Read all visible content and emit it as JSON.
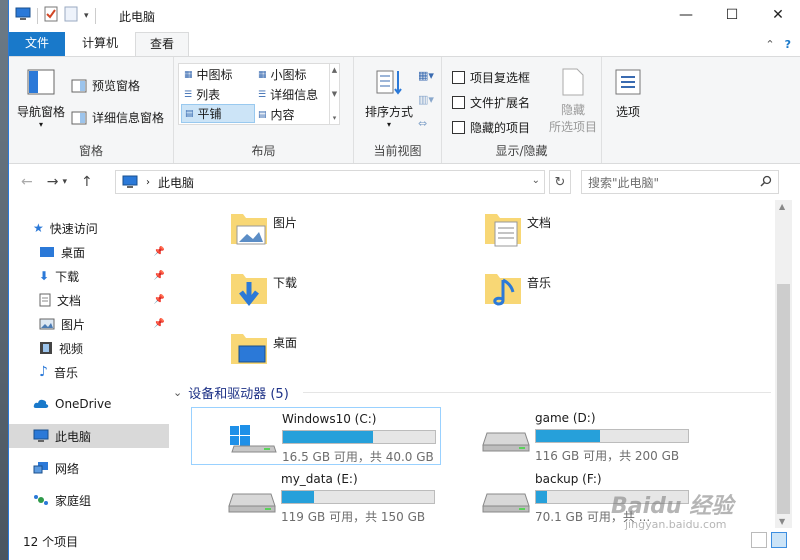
{
  "window": {
    "title": "此电脑"
  },
  "tabs": {
    "file": "文件",
    "computer": "计算机",
    "view": "查看"
  },
  "ribbon": {
    "pane": {
      "nav_pane": "导航窗格",
      "preview_pane": "预览窗格",
      "details_pane": "详细信息窗格",
      "label": "窗格"
    },
    "layout": {
      "items": [
        "中图标",
        "小图标",
        "列表",
        "详细信息",
        "平铺",
        "内容"
      ],
      "selected": "平铺",
      "label": "布局"
    },
    "current_view": {
      "sort": "排序方式",
      "label": "当前视图"
    },
    "show_hide": {
      "item_checkbox": "项目复选框",
      "file_ext": "文件扩展名",
      "hidden_items": "隐藏的项目",
      "hide": "隐藏",
      "selected_items": "所选项目",
      "label": "显示/隐藏"
    },
    "options": {
      "label": "选项"
    }
  },
  "address": {
    "path": "此电脑",
    "search_placeholder": "搜索\"此电脑\""
  },
  "sidebar": {
    "quick_access": "快速访问",
    "items": [
      "桌面",
      "下载",
      "文档",
      "图片",
      "视频",
      "音乐"
    ],
    "onedrive": "OneDrive",
    "this_pc": "此电脑",
    "network": "网络",
    "homegroup": "家庭组"
  },
  "folders": [
    "图片",
    "文档",
    "下载",
    "音乐",
    "桌面"
  ],
  "devices": {
    "header": "设备和驱动器 (5)",
    "drives": [
      {
        "name": "Windows10 (C:)",
        "info": "16.5 GB 可用，共 40.0 GB",
        "used_fraction": 0.59
      },
      {
        "name": "game (D:)",
        "info": "116 GB 可用，共 200 GB",
        "used_fraction": 0.42
      },
      {
        "name": "my_data (E:)",
        "info": "119 GB 可用，共 150 GB",
        "used_fraction": 0.21
      },
      {
        "name": "backup (F:)",
        "info": "70.1 GB 可用，共 ...",
        "used_fraction": 0.07
      }
    ]
  },
  "status": {
    "count": "12 个项目"
  },
  "watermark": {
    "text": "Baidu 经验",
    "url": "jingyan.baidu.com"
  },
  "colors": {
    "accent": "#1979ca",
    "drive_fill": "#26a0da",
    "section_head": "#1e3287"
  }
}
